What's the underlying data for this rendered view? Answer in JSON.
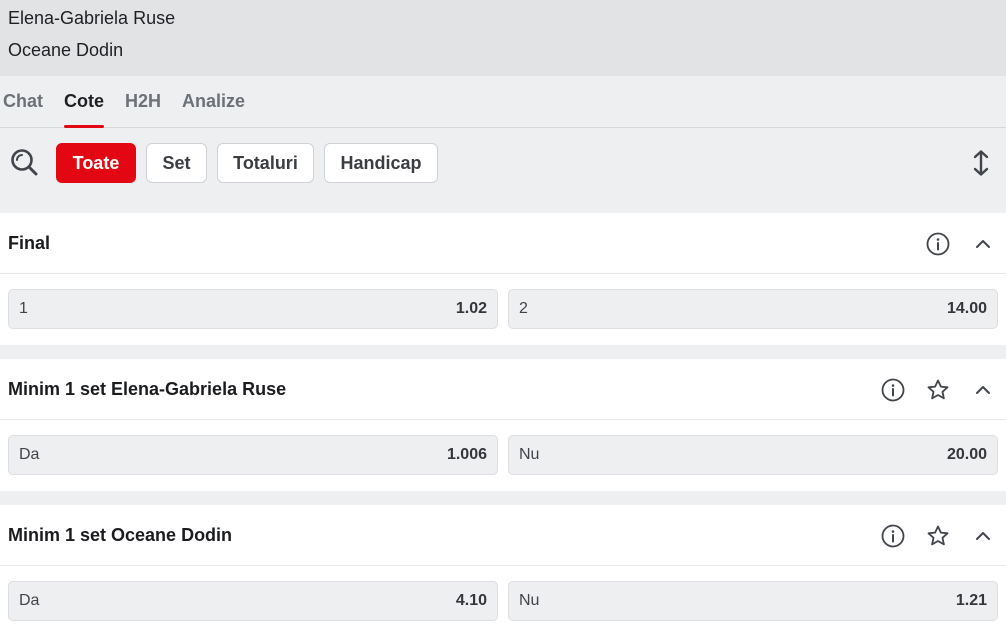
{
  "match": {
    "player1": "Elena-Gabriela Ruse",
    "player2": "Oceane Dodin"
  },
  "tabs": [
    {
      "label": "Chat",
      "active": false
    },
    {
      "label": "Cote",
      "active": true
    },
    {
      "label": "H2H",
      "active": false
    },
    {
      "label": "Analize",
      "active": false
    }
  ],
  "filters": [
    {
      "label": "Toate",
      "active": true
    },
    {
      "label": "Set",
      "active": false
    },
    {
      "label": "Totaluri",
      "active": false
    },
    {
      "label": "Handicap",
      "active": false
    }
  ],
  "icons": {
    "search": "search-icon",
    "expand": "expand-vertical-icon",
    "info": "info-icon",
    "favorite": "star-icon",
    "collapse": "chevron-up-icon"
  },
  "colors": {
    "accent": "#e30613",
    "panel": "#ffffff",
    "background": "#eeeff1"
  },
  "markets": [
    {
      "title": "Final",
      "outcomes": [
        {
          "label": "1",
          "odds": "1.02"
        },
        {
          "label": "2",
          "odds": "14.00"
        }
      ]
    },
    {
      "title": "Minim 1 set Elena-Gabriela Ruse",
      "outcomes": [
        {
          "label": "Da",
          "odds": "1.006"
        },
        {
          "label": "Nu",
          "odds": "20.00"
        }
      ]
    },
    {
      "title": "Minim 1 set Oceane Dodin",
      "outcomes": [
        {
          "label": "Da",
          "odds": "4.10"
        },
        {
          "label": "Nu",
          "odds": "1.21"
        }
      ]
    }
  ]
}
